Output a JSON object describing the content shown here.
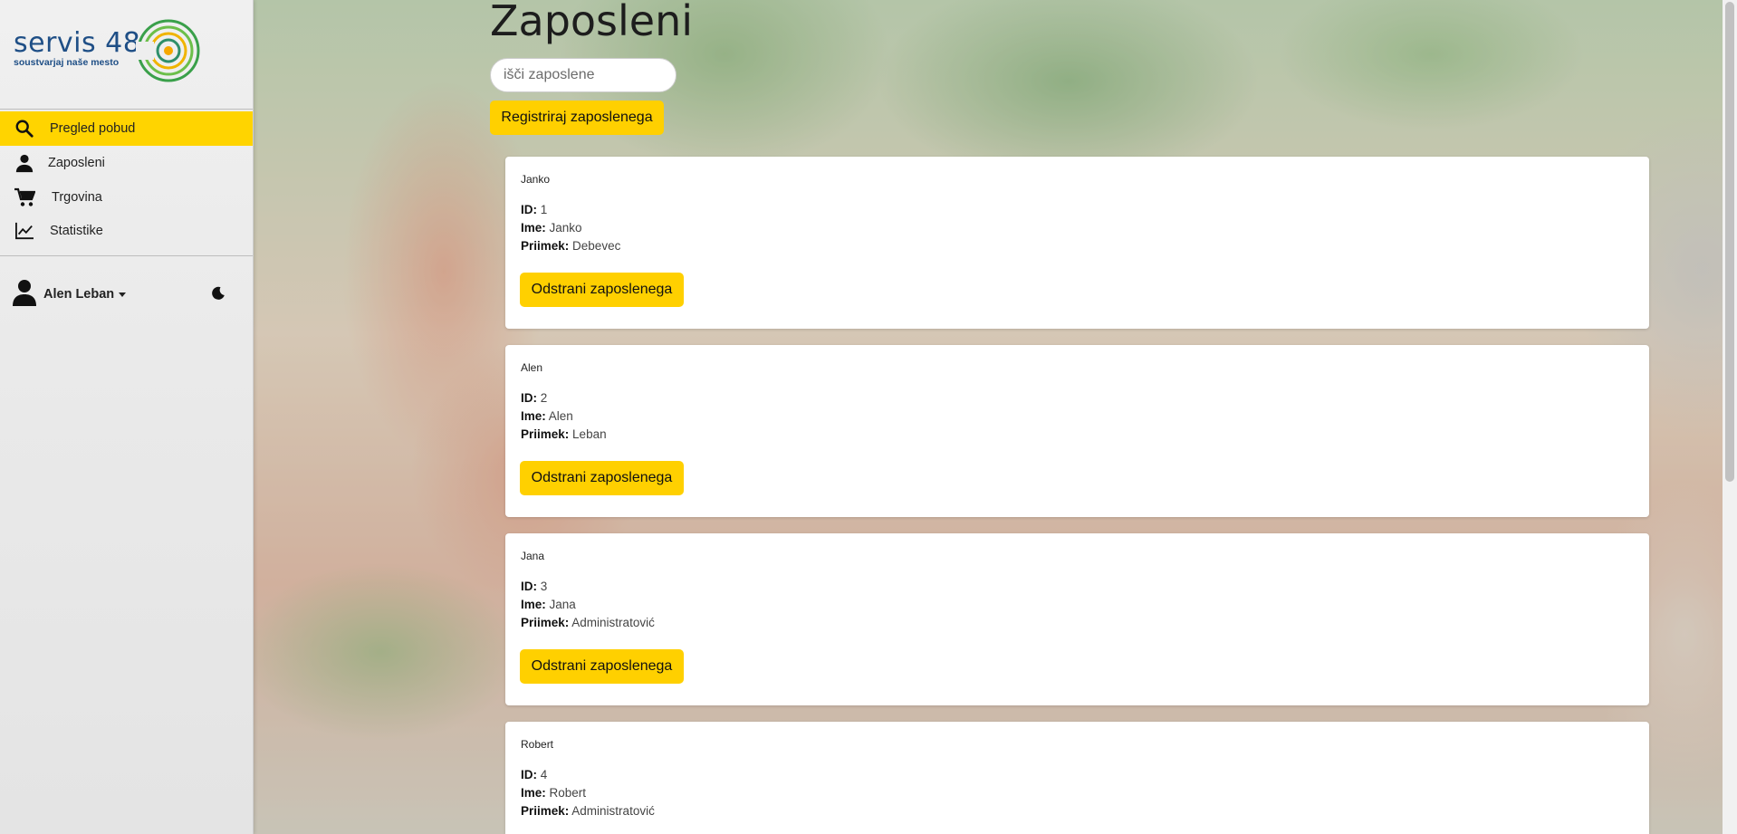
{
  "app": {
    "logo_title": "servis 48",
    "logo_subtitle": "soustvarjaj naše mesto"
  },
  "sidebar": {
    "items": [
      {
        "label": "Pregled pobud",
        "icon": "search-icon",
        "active": true
      },
      {
        "label": "Zaposleni",
        "icon": "person-icon",
        "active": false
      },
      {
        "label": "Trgovina",
        "icon": "cart-icon",
        "active": false
      },
      {
        "label": "Statistike",
        "icon": "chart-line-icon",
        "active": false
      }
    ],
    "user_name": "Alen Leban",
    "theme_toggle_icon": "moon-icon"
  },
  "main": {
    "title": "Zaposleni",
    "search_placeholder": "išči zaposlene",
    "register_label": "Registriraj zaposlenega",
    "field_labels": {
      "id": "ID:",
      "ime": "Ime:",
      "priimek": "Priimek:"
    },
    "remove_label": "Odstrani zaposlenega",
    "employees": [
      {
        "name": "Janko",
        "id": "1",
        "ime": "Janko",
        "priimek": "Debevec"
      },
      {
        "name": "Alen",
        "id": "2",
        "ime": "Alen",
        "priimek": "Leban"
      },
      {
        "name": "Jana",
        "id": "3",
        "ime": "Jana",
        "priimek": "Administratović"
      },
      {
        "name": "Robert",
        "id": "4",
        "ime": "Robert",
        "priimek": "Administratović"
      }
    ]
  },
  "colors": {
    "accent": "#ffd000",
    "brand_blue": "#1f4f86",
    "brand_green": "#3aa04a"
  }
}
